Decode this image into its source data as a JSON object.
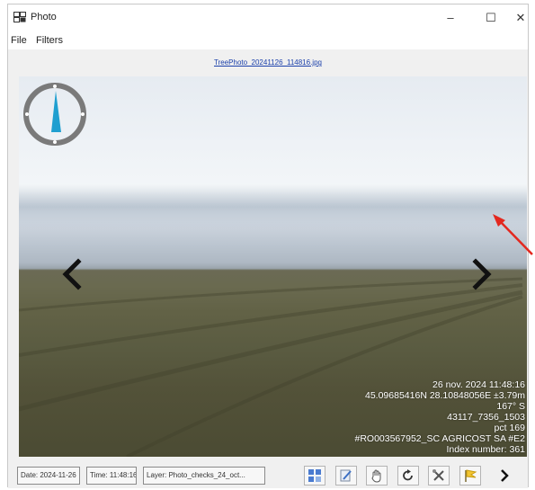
{
  "window": {
    "title": "Photo",
    "controls": {
      "minimize": "–",
      "maximize": "☐",
      "close": "✕"
    }
  },
  "menu": {
    "file": "File",
    "filters": "Filters"
  },
  "photo": {
    "filename": "TreePhoto_20241126_114816.jpg",
    "compass_heading_deg": 167,
    "info": {
      "datetime": "26 nov. 2024 11:48:16",
      "coords": "45.09685416N 28.10848056E ±3.79m",
      "heading": "167° S",
      "id": "43117_7356_1503",
      "point": "pct 169",
      "owner": "#RO003567952_SC AGRICOST SA #E2",
      "index": "Index number: 361"
    }
  },
  "status": {
    "date": "Date: 2024-11-26",
    "time": "Time: 11:48:16",
    "layer": "Layer: Photo_checks_24_oct..."
  },
  "toolbar": {
    "icons": [
      "gallery-icon",
      "edit-icon",
      "pan-hand-icon",
      "rotate-icon",
      "tools-icon",
      "flag-icon",
      "next-arrow-icon"
    ]
  },
  "colors": {
    "compass_ring": "#7a7a7a",
    "compass_needle": "#1f9fd0",
    "annotation_arrow": "#e3281f",
    "link": "#1a3faa"
  }
}
